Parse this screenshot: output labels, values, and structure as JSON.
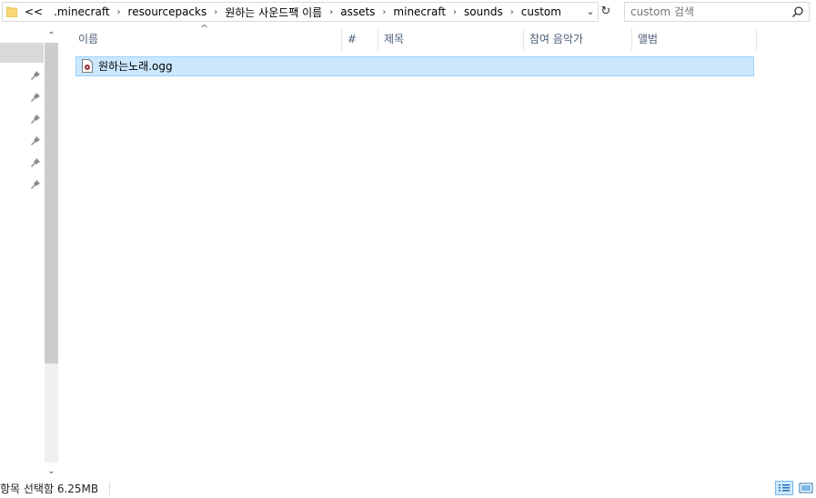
{
  "address": {
    "prefix": "<<",
    "crumbs": [
      ".minecraft",
      "resourcepacks",
      "원하는 사운드팩 이름",
      "assets",
      "minecraft",
      "sounds",
      "custom"
    ]
  },
  "search": {
    "placeholder": "custom 검색"
  },
  "columns": {
    "name": "이름",
    "number": "#",
    "title": "제목",
    "artist": "참여 음악가",
    "album": "앨범"
  },
  "files": [
    {
      "name": "원하는노래.ogg"
    }
  ],
  "status": {
    "text": "항목 선택함 6.25MB"
  },
  "icons": {
    "folder": "folder-icon",
    "dropdown": "chevron-down-icon",
    "refresh": "refresh-icon",
    "search": "search-icon",
    "pin": "pin-icon",
    "file": "audio-file-icon"
  },
  "colors": {
    "selection": "#cce8ff",
    "selection_border": "#99d1ff",
    "header_text": "#4c607a"
  }
}
